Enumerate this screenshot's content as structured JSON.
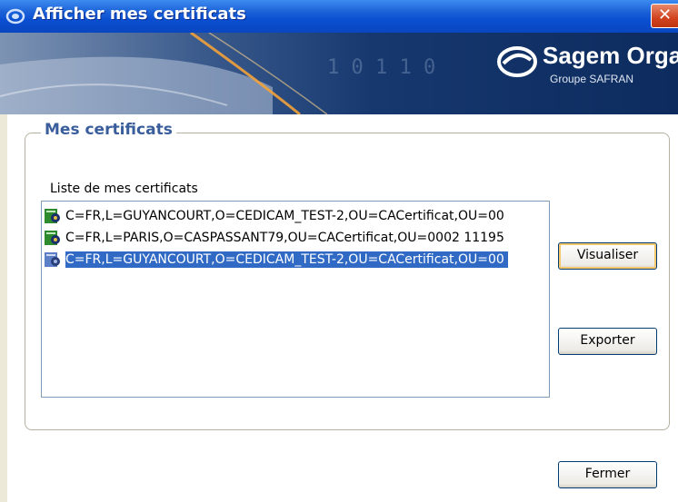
{
  "window": {
    "title": "Afficher mes certificats",
    "close_label": "✕"
  },
  "banner": {
    "brand_name": "Sagem Orga",
    "brand_sub": "Groupe SAFRAN"
  },
  "group": {
    "legend": "Mes certificats",
    "list_label": "Liste de mes certificats",
    "certificates": [
      {
        "label": "C=FR,L=GUYANCOURT,O=CEDICAM_TEST-2,OU=CACertificat,OU=00",
        "selected": false,
        "icon": "certificate-icon"
      },
      {
        "label": "C=FR,L=PARIS,O=CASPASSANT79,OU=CACertificat,OU=0002 11195",
        "selected": false,
        "icon": "certificate-icon"
      },
      {
        "label": "C=FR,L=GUYANCOURT,O=CEDICAM_TEST-2,OU=CACertificat,OU=00",
        "selected": true,
        "icon": "certificate-icon"
      }
    ]
  },
  "buttons": {
    "visualiser": "Visualiser",
    "exporter": "Exporter",
    "fermer": "Fermer"
  },
  "colors": {
    "title_bar": "#0b4fd1",
    "selection": "#316ac5",
    "legend_text": "#3a5e9c",
    "close_button": "#d1431e"
  }
}
